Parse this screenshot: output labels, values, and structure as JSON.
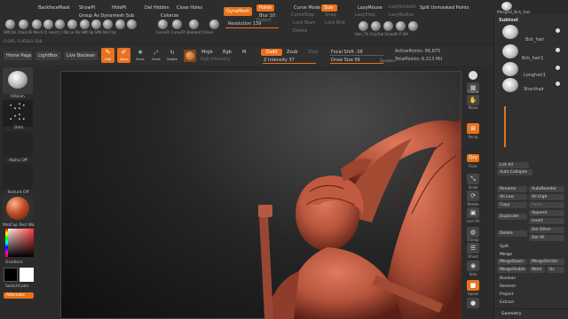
{
  "top_toolbar": {
    "row1": [
      "BackfaceMask",
      "ShowPt",
      "HidePt",
      "Del Hidden",
      "Close Holes"
    ],
    "group_label": "Group As Dynamesh Sub",
    "colorize": "Colorize",
    "brushes": [
      "SMt",
      "Dn",
      "Chain",
      "Bi",
      "Mech",
      "Cl",
      "insert_rl",
      "Nb",
      "Le",
      "Rb",
      "SMt",
      "Sb",
      "SMt",
      "Ret",
      "Flat",
      "Curve",
      "Ch",
      "CurveTr",
      "Cu",
      "BioHard",
      "Chisel"
    ],
    "dynamesh": "DynaMesh",
    "polish": "Polish",
    "blur": "Blur 10",
    "projectt": "Project",
    "resolution": "Resolution 1392",
    "curve_mode": "Curve Mode",
    "size": "Size",
    "snap": "Snap",
    "edge": "Edge",
    "lock_start": "Lock Start",
    "lock_end": "Lock End",
    "delete": "Delete",
    "lazymouse": "LazyMouse",
    "lazystep": "LazyStep",
    "lazysmooth": "LazySmooth",
    "lazyradius": "LazyRadius",
    "split_unmasked": "Split Unmasked Points",
    "hair": [
      "Hair_Th",
      "ClayTub",
      "Smooth",
      "P",
      "SM"
    ],
    "merged": "Merged_Bck_hair"
  },
  "coords": "0.005,-1.958,0.118",
  "second_bar": {
    "home": "Home Page",
    "lightbox": "LightBox",
    "live_boolean": "Live Boolean",
    "edit": "Edit",
    "draw": "Draw",
    "move": "Move",
    "scale": "Scale",
    "rotate": "Rotate",
    "mrgb": "Mrgb",
    "rgb": "Rgb",
    "m": "M",
    "rgb_intensity": "Rgb Intensity",
    "zadd": "Zadd",
    "zsub": "Zsub",
    "zcut": "Zcut",
    "z_intensity": "Z Intensity 37",
    "focal_shift": "Focal Shift -38",
    "draw_size": "Draw Size 56",
    "dynamic": "Dynamic",
    "active_points": "ActivePoints: 86,675",
    "total_points": "TotalPoints: 6.213 Mil"
  },
  "left_shelf": {
    "brush_label": "hPolish",
    "stroke_label": "Dots",
    "alpha_label": "Alpha Off",
    "texture_label": "Texture Off",
    "material_label": "MatCap Red Wa",
    "gradient_label": "Gradient",
    "switch_label": "SwitchColor",
    "alternate_label": "Alternate"
  },
  "right_tools": [
    "Frame",
    "Move",
    "Scale",
    "Rotate",
    "Local",
    "Floor",
    "Persp",
    "Transp",
    "Solo",
    "Dynamic",
    "Xpose",
    "PolyF",
    "Line Fill",
    "Ghost"
  ],
  "subtool": {
    "header": "Subtool",
    "items": [
      "Bck_hair",
      "Bck_hair1",
      "Longhair1",
      "Shorthair"
    ],
    "list_all": "List All",
    "auto_collapse": "Auto Collapse",
    "rename": "Rename",
    "auto_reorder": "AutoReorder",
    "all_low": "All Low",
    "all_high": "All High",
    "copy": "Copy",
    "paste": "Paste",
    "append": "Append",
    "duplicate": "Duplicate",
    "insert": "Insert",
    "del_other": "Del Other",
    "delete": "Delete",
    "del_all": "Del All",
    "split": "Split",
    "merge": "Merge",
    "merge_down": "MergeDown",
    "merge_similar": "MergeSimilar",
    "merge_visible": "MergeVisible",
    "weld": "Weld",
    "uv": "Uv",
    "boolean": "Boolean",
    "remesh": "Remesh",
    "project": "Project",
    "extract": "Extract",
    "geometry": "Geometry"
  },
  "colors": {
    "accent": "#e8721c",
    "clay": "#b5533c"
  }
}
